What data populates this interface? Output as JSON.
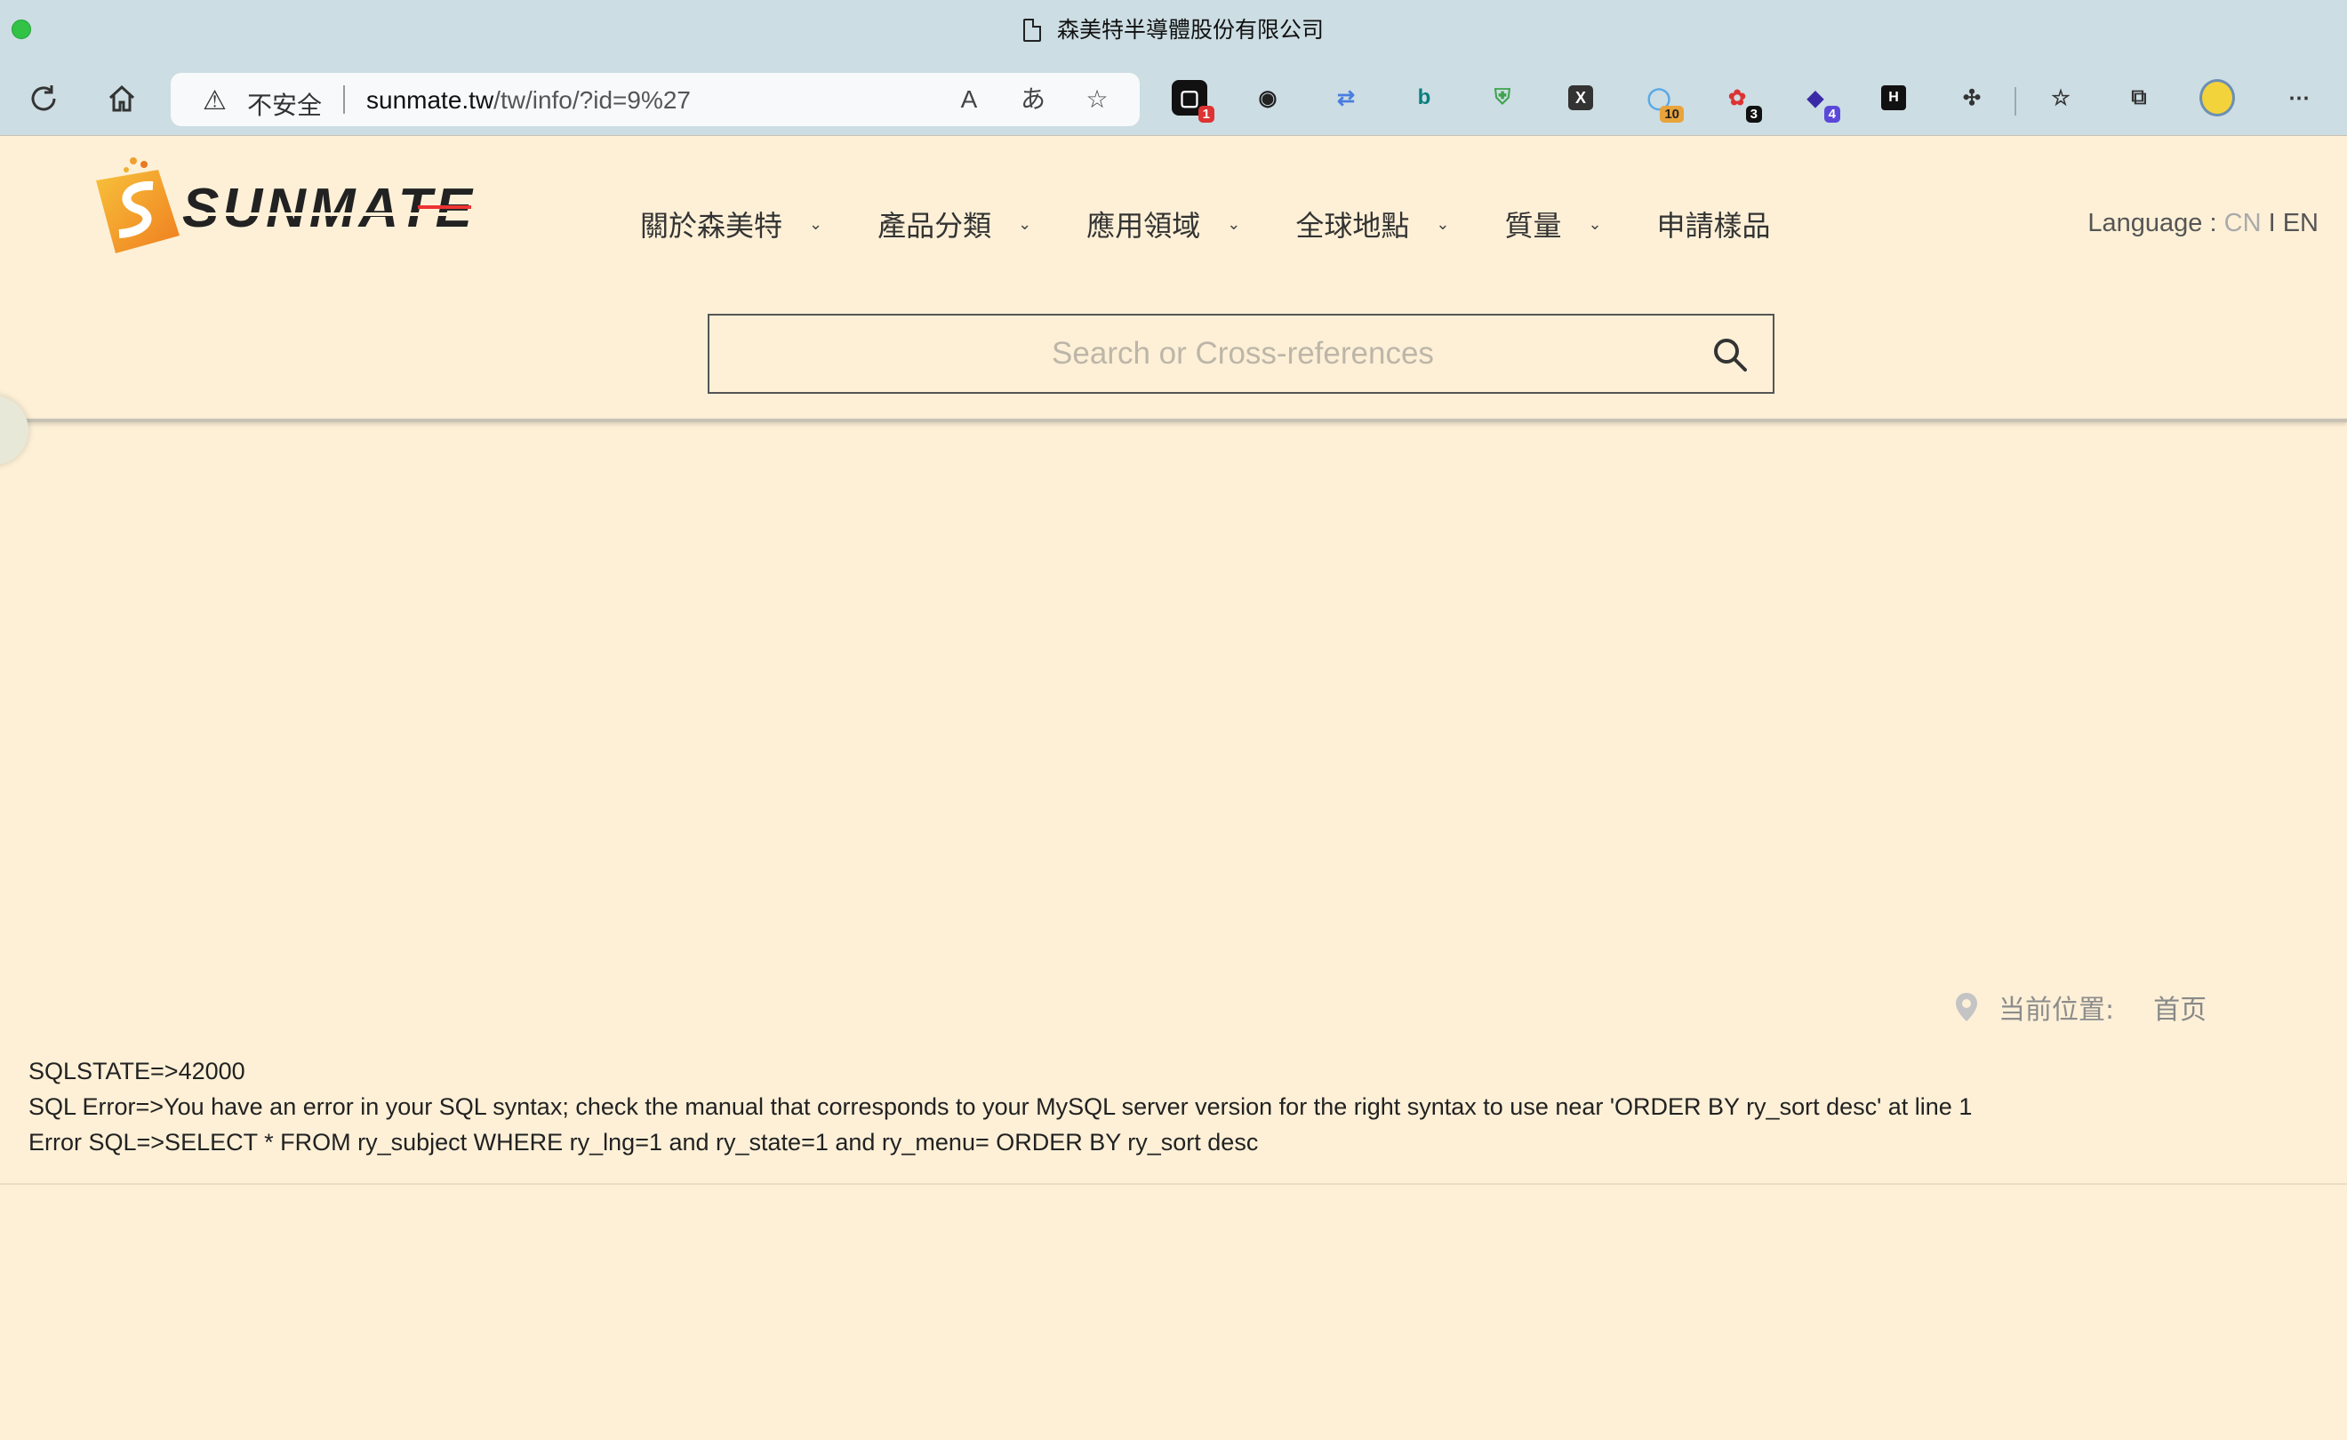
{
  "browser": {
    "tab_title": "森美特半導體股份有限公司",
    "security_label": "不安全",
    "url_host": "sunmate.tw",
    "url_path": "/tw/info/?id=9%27",
    "extensions": [
      {
        "name": "ext-1",
        "badge": "1"
      },
      {
        "name": "ext-glasses",
        "badge": ""
      },
      {
        "name": "ext-repeat",
        "badge": ""
      },
      {
        "name": "ext-bing",
        "badge": ""
      },
      {
        "name": "ext-shield",
        "badge": ""
      },
      {
        "name": "ext-x",
        "badge": ""
      },
      {
        "name": "ext-circle",
        "badge": "10"
      },
      {
        "name": "ext-red",
        "badge": "3"
      },
      {
        "name": "ext-purple",
        "badge": "4"
      },
      {
        "name": "ext-h",
        "badge": ""
      }
    ]
  },
  "site": {
    "logo_text": "SUNMATE",
    "nav": [
      "關於森美特",
      "產品分類",
      "應用領域",
      "全球地點",
      "質量",
      "申請樣品"
    ],
    "language_label": "Language :",
    "lang_cn": "CN",
    "lang_sep": "I",
    "lang_en": "EN",
    "search_placeholder": "Search or Cross-references",
    "breadcrumb_label": "当前位置:",
    "breadcrumb_home": "首页"
  },
  "error": {
    "line1": "SQLSTATE=>42000",
    "line2": "SQL Error=>You have an error in your SQL syntax; check the manual that corresponds to your MySQL server version for the right syntax to use near 'ORDER BY ry_sort desc' at line 1",
    "line3": "Error SQL=>SELECT * FROM ry_subject WHERE ry_lng=1 and ry_state=1 and ry_menu= ORDER BY ry_sort desc"
  }
}
